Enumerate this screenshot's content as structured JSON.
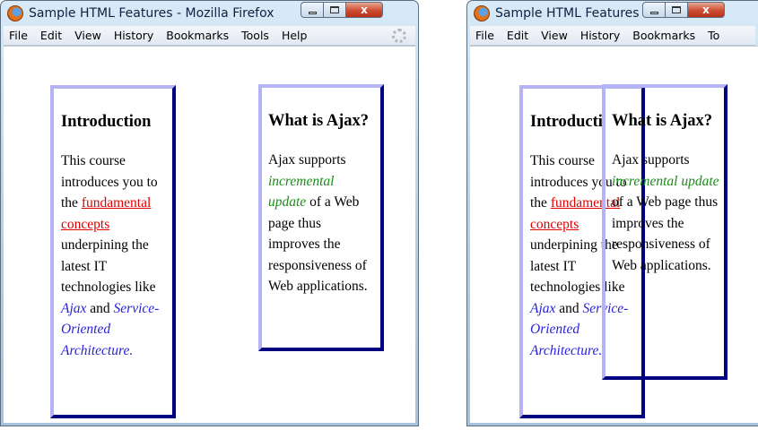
{
  "window": {
    "title_full": "Sample HTML Features - Mozilla Firefox",
    "title_truncated": "Sample HTML Features - ...",
    "close_glyph": "x"
  },
  "menu": {
    "file": "File",
    "edit": "Edit",
    "view": "View",
    "history": "History",
    "bookmarks": "Bookmarks",
    "tools": "Tools",
    "help": "Help",
    "tools_truncated": "To"
  },
  "intro": {
    "heading": "Introduction",
    "heading_cut": "Introducti",
    "text_1": "This course introduces you to the",
    "link": "fundamental concepts",
    "text_2": "underpining the latest IT technologies like",
    "ajax_link": "Ajax",
    "and": "and",
    "soa_link": "Service-Oriented Architecture",
    "period": "."
  },
  "ajax": {
    "heading": "What is Ajax?",
    "text_1": "Ajax supports",
    "incremental": "incremental update",
    "text_2": "of a Web page thus improves the responsiveness of Web applications."
  },
  "colors": {
    "box_light": "#b3b3f5",
    "box_dark": "#000080",
    "link_red": "#e00000",
    "link_blue": "#2a22d8",
    "link_green": "#1a8a1a"
  },
  "icons": [
    "firefox-logo-icon",
    "minimize-icon",
    "maximize-icon",
    "close-icon",
    "throbber-icon"
  ]
}
